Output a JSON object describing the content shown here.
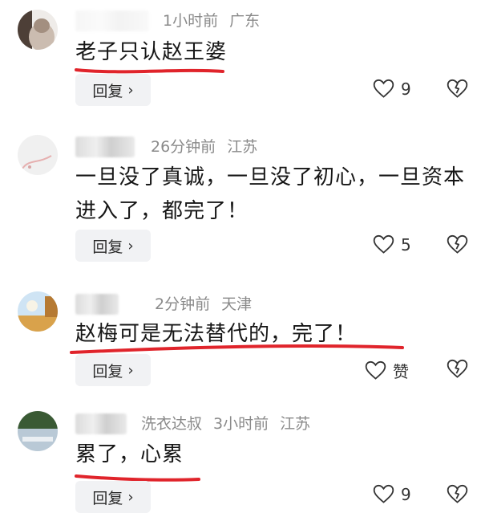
{
  "comments": [
    {
      "time": "1小时前",
      "location": "广东",
      "text": "老子只认赵王婆",
      "reply_label": "回复",
      "like_count": "9"
    },
    {
      "time": "26分钟前",
      "location": "江苏",
      "text": "一旦没了真诚，一旦没了初心，一旦资本进入了，都完了！",
      "reply_label": "回复",
      "like_count": "5"
    },
    {
      "time": "2分钟前",
      "location": "天津",
      "text": "赵梅可是无法替代的，完了！",
      "reply_label": "回复",
      "like_count": "赞"
    },
    {
      "username": "洗衣达叔",
      "time": "3小时前",
      "location": "江苏",
      "text": "累了，心累",
      "reply_label": "回复",
      "like_count": "9"
    }
  ],
  "icons": {
    "reply_chevron": "chevron-right-icon",
    "like": "heart-outline-icon",
    "dislike": "broken-heart-icon"
  },
  "colors": {
    "underline": "#e0242b",
    "meta_text": "#8a8a8a",
    "reply_bg": "#f1f2f4"
  }
}
